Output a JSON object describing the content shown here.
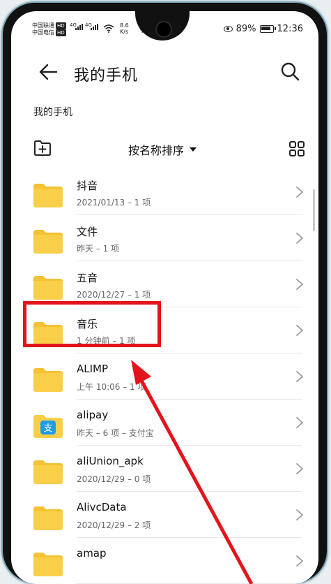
{
  "status_bar": {
    "carrier1": "中国联通",
    "carrier2": "中国电信",
    "hd": "HD",
    "net1": "4G",
    "net2": "4G",
    "speed_value": "8.6",
    "speed_unit": "K/s",
    "battery_percent": "89%",
    "time": "12:36"
  },
  "header": {
    "title": "我的手机"
  },
  "breadcrumb": "我的手机",
  "toolbar": {
    "sort_label": "按名称排序"
  },
  "files": [
    {
      "name": "抖音",
      "meta": "2021/01/13 – 1 项",
      "icon": "folder-icon"
    },
    {
      "name": "文件",
      "meta": "昨天 – 1 项",
      "icon": "folder-icon"
    },
    {
      "name": "五音",
      "meta": "2020/12/27 – 1 项",
      "icon": "folder-icon"
    },
    {
      "name": "音乐",
      "meta": "1 分钟前 – 1 项",
      "icon": "folder-icon"
    },
    {
      "name": "ALIMP",
      "meta": "上午 10:06 – 1 项",
      "icon": "folder-icon"
    },
    {
      "name": "alipay",
      "meta": "昨天 – 6 项 – 支付宝",
      "icon": "alipay-folder-icon"
    },
    {
      "name": "aliUnion_apk",
      "meta": "2020/12/29 – 0 项",
      "icon": "folder-icon"
    },
    {
      "name": "AlivcData",
      "meta": "2020/12/29 – 2 项",
      "icon": "folder-icon"
    },
    {
      "name": "amap",
      "meta": "",
      "icon": "folder-icon"
    }
  ],
  "colors": {
    "folder": "#f9cf4a",
    "folder_tab": "#f4c232",
    "highlight": "#e3141c",
    "alipay": "#1e9ce8"
  }
}
